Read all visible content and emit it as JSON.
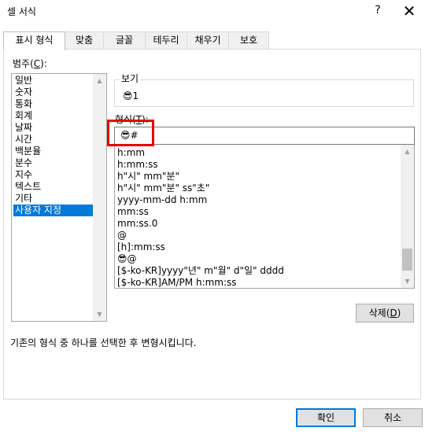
{
  "window": {
    "title": "셀 서식",
    "help": "?",
    "close": "✕"
  },
  "tabs": [
    {
      "label": "표시 형식",
      "active": true
    },
    {
      "label": "맞춤"
    },
    {
      "label": "글꼴"
    },
    {
      "label": "테두리"
    },
    {
      "label": "채우기"
    },
    {
      "label": "보호"
    }
  ],
  "category": {
    "label_prefix": "범주(",
    "label_key": "C",
    "label_suffix": "):",
    "items": [
      "일반",
      "숫자",
      "통화",
      "회계",
      "날짜",
      "시간",
      "백분율",
      "분수",
      "지수",
      "텍스트",
      "기타",
      "사용자 지정"
    ],
    "selected": "사용자 지정"
  },
  "sample": {
    "label": "보기",
    "value": "😎1"
  },
  "format": {
    "label_prefix": "형식(",
    "label_key": "T",
    "label_suffix": "):",
    "value": "😎#",
    "items": [
      "h:mm",
      "h:mm:ss",
      "h\"시\" mm\"분\"",
      "h\"시\" mm\"분\" ss\"초\"",
      "yyyy-mm-dd h:mm",
      "mm:ss",
      "mm:ss.0",
      "@",
      "[h]:mm:ss",
      "😎@",
      "[$-ko-KR]yyyy\"년\" m\"월\" d\"일\" dddd",
      "[$-ko-KR]AM/PM h:mm:ss"
    ]
  },
  "delete_btn": {
    "prefix": "삭제(",
    "key": "D",
    "suffix": ")"
  },
  "description": "기존의 형식 중 하나를 선택한 후 변형시킵니다.",
  "ok_label": "확인",
  "cancel_label": "취소",
  "colors": {
    "selection": "#0078d7",
    "highlight": "#e60000"
  }
}
